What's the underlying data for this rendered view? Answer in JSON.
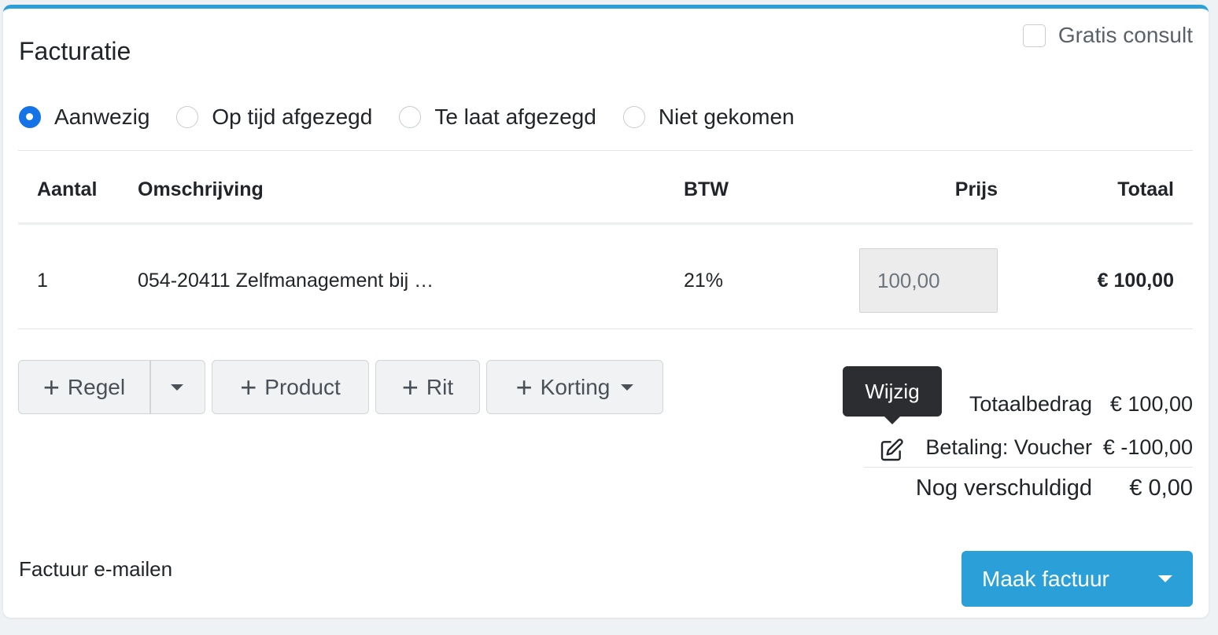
{
  "panel": {
    "title": "Facturatie",
    "gratis_consult": {
      "label": "Gratis consult",
      "checked": false
    }
  },
  "attendance": {
    "options": [
      {
        "label": "Aanwezig",
        "checked": true
      },
      {
        "label": "Op tijd afgezegd",
        "checked": false
      },
      {
        "label": "Te laat afgezegd",
        "checked": false
      },
      {
        "label": "Niet gekomen",
        "checked": false
      }
    ]
  },
  "table": {
    "headers": {
      "aantal": "Aantal",
      "omschrijving": "Omschrijving",
      "btw": "BTW",
      "prijs": "Prijs",
      "totaal": "Totaal"
    },
    "rows": [
      {
        "aantal": "1",
        "omschrijving": "054-20411 Zelfmanagement bij …",
        "btw": "21%",
        "prijs": "100,00",
        "totaal": "€ 100,00"
      }
    ]
  },
  "actions": {
    "regel": "Regel",
    "product": "Product",
    "rit": "Rit",
    "korting": "Korting"
  },
  "tooltip": "Wijzig",
  "summary": {
    "totaalbedrag_label": "Totaalbedrag",
    "totaalbedrag_value": "€ 100,00",
    "betaling_label": "Betaling: Voucher",
    "betaling_value": "€ -100,00",
    "verschuldigd_label": "Nog verschuldigd",
    "verschuldigd_value": "€ 0,00"
  },
  "footer": {
    "email_link": "Factuur e-mailen",
    "make_invoice": "Maak factuur"
  },
  "colors": {
    "accent": "#2a9fd8",
    "radio_checked": "#1473e6",
    "tooltip_bg": "#2b2d30"
  }
}
